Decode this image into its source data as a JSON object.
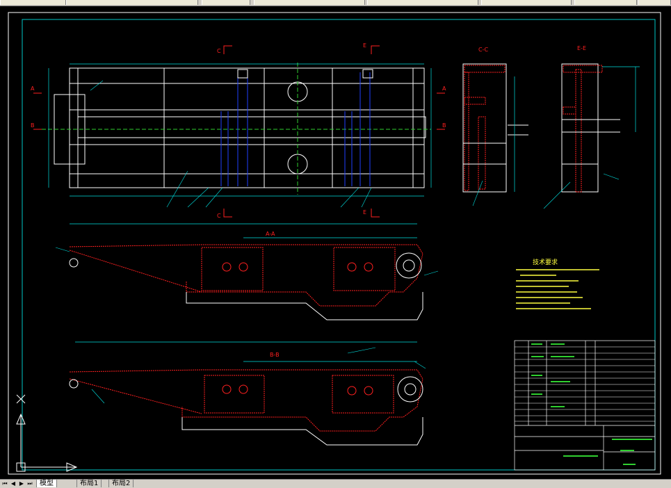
{
  "taskbar": {
    "items": [
      "",
      "",
      "",
      "",
      "",
      "",
      "",
      ""
    ]
  },
  "views": {
    "section_c": "C",
    "section_e": "E",
    "section_a": "A",
    "section_b": "B",
    "view_cc": "C-C",
    "view_ee": "E-E",
    "view_aa": "A-A",
    "view_bb": "B-B"
  },
  "notes": {
    "title": "技术要求"
  },
  "tabs": {
    "model": "模型",
    "layout1": "布局1",
    "layout2": "布局2"
  },
  "colors": {
    "frame": "#ffffff",
    "border": "#00c8c8",
    "dimension": "#00e0e0",
    "red_section": "#ff2020",
    "blue_lines": "#2040ff",
    "green_center": "#30d030",
    "notes_text": "#ffff40"
  }
}
